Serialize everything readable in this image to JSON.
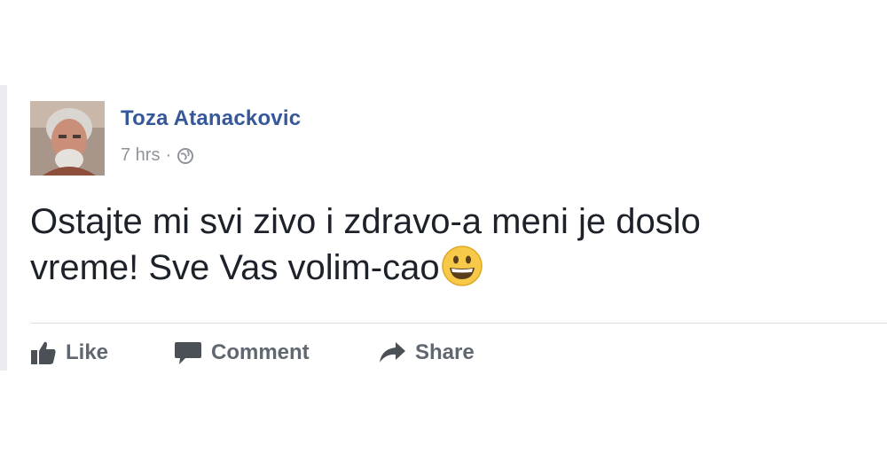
{
  "post": {
    "author": "Toza Atanackovic",
    "time": "7 hrs",
    "separator": "·",
    "text_line1": "Ostajte mi svi zivo i zdravo-a meni je doslo",
    "text_line2": "vreme! Sve Vas volim-cao",
    "emoji": "grinning-face-emoji"
  },
  "actions": {
    "like_label": "Like",
    "comment_label": "Comment",
    "share_label": "Share"
  },
  "colors": {
    "author": "#365899",
    "meta": "#90949c",
    "text": "#1d2129",
    "action": "#616770"
  }
}
